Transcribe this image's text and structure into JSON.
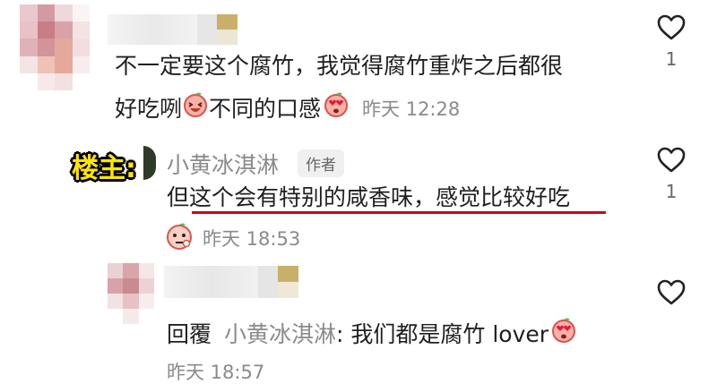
{
  "comments": [
    {
      "text_line1": "不一定要这个腐竹，我觉得腐竹重炸之后都很",
      "text_line2": "好吃咧",
      "text_line2_tail": "不同的口感",
      "time": "昨天 12:28",
      "likes": "1"
    }
  ],
  "reply1": {
    "badge": "楼主:",
    "name": "小黄冰淇淋",
    "author_tag": "作者",
    "text": "但这个会有特别的咸香味，感觉比较好吃",
    "time": "昨天 18:53",
    "likes": "1"
  },
  "reply2": {
    "prefix": "回覆",
    "name": "小黄冰淇淋",
    "text": ": 我们都是腐竹 lover",
    "time": "昨天 18:57"
  },
  "colors": {
    "highlight_underline": "#d0021b",
    "badge_yellow": "#ffe600"
  },
  "icons": [
    "heart-outline-icon",
    "laughing-peach-emoji",
    "heart-eyes-emoji",
    "thinking-peach-avatar"
  ]
}
